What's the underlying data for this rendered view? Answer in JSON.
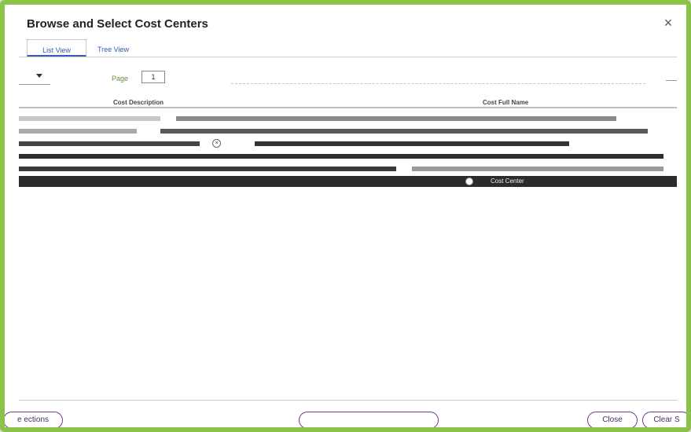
{
  "dialog": {
    "title": "Browse and Select Cost Centers",
    "close_glyph": "×"
  },
  "tabs": [
    {
      "label": "List View"
    },
    {
      "label": "Tree View"
    }
  ],
  "toolbar": {
    "page_label": "Page",
    "page_value": "1"
  },
  "grid": {
    "columns": [
      "Cost Description",
      "Cost Full Name"
    ],
    "selected_row_label": "Cost Center"
  },
  "footer": {
    "selections_label": "e ections",
    "close_label": "Close",
    "clear_label": "Clear S"
  },
  "colors": {
    "frame_border": "#8bc34a",
    "accent": "#2f5fb3",
    "button_border": "#6b3a8a"
  },
  "icons": [
    "close-icon",
    "chevron-down-icon",
    "radio-icon",
    "row-icon"
  ]
}
